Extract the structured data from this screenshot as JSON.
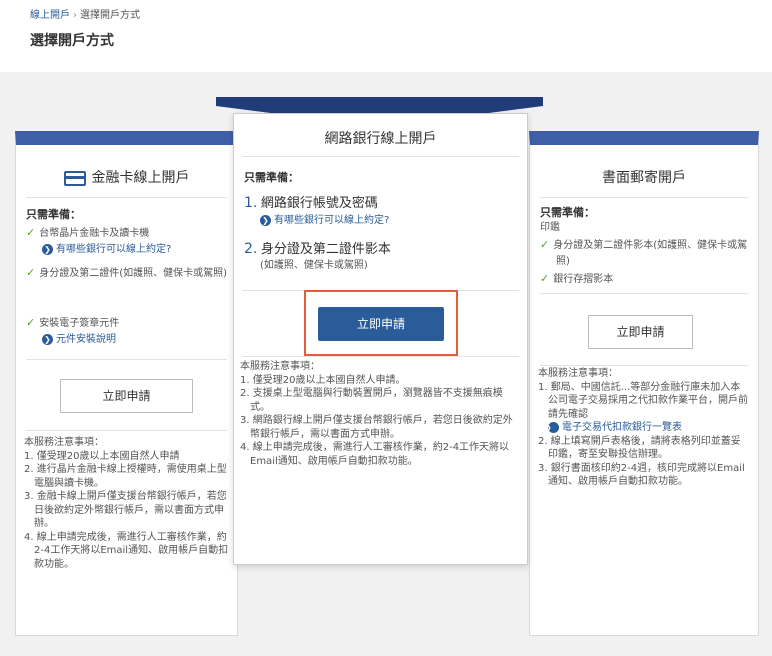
{
  "breadcrumb": {
    "home": "線上開戶",
    "sep": "›",
    "current": "選擇開戶方式"
  },
  "page_title": "選擇開戶方式",
  "left_card": {
    "title": "金融卡線上開戶",
    "prepare_label": "只需準備：",
    "items": [
      {
        "text": "台幣晶片金融卡及讀卡機",
        "link": "有哪些銀行可以線上約定?"
      },
      {
        "text": "身分證及第二證件(如護照、健保卡或駕照)"
      },
      {
        "text": "安裝電子簽章元件",
        "link": "元件安裝說明"
      }
    ],
    "apply_label": "立即申請",
    "notes_title": "本服務注意事項：",
    "notes": [
      "1. 僅受理20歲以上本國自然人申請",
      "2. 進行晶片金融卡線上授權時，需使用桌上型電腦與讀卡機。",
      "3. 金融卡線上開戶僅支援台幣銀行帳戶，若您日後欲約定外幣銀行帳戶，需以書面方式申辦。",
      "4. 線上申請完成後，需進行人工審核作業，約2-4工作天將以Email通知、啟用帳戶自動扣款功能。"
    ]
  },
  "mid_card": {
    "title": "網路銀行線上開戶",
    "prepare_label": "只需準備：",
    "item1_num": "1.",
    "item1_text": "網路銀行帳號及密碼",
    "item1_link": "有哪些銀行可以線上約定?",
    "item2_num": "2.",
    "item2_text": "身分證及第二證件影本",
    "item2_sub": "(如護照、健保卡或駕照)",
    "apply_label": "立即申請",
    "notes_title": "本服務注意事項：",
    "notes": [
      "1. 僅受理20歲以上本國自然人申請。",
      "2. 支援桌上型電腦與行動裝置開戶，瀏覽器皆不支援無痕模式。",
      "3. 網路銀行線上開戶僅支援台幣銀行帳戶，若您日後欲約定外幣銀行帳戶，需以書面方式申辦。",
      "4. 線上申請完成後，需進行人工審核作業，約2-4工作天將以Email通知、啟用帳戶自動扣款功能。"
    ]
  },
  "right_card": {
    "title": "書面郵寄開戶",
    "prepare_label": "只需準備：",
    "sub_label": "印鑑",
    "items": [
      {
        "text": "身分證及第二證件影本(如護照、健保卡或駕照)"
      },
      {
        "text": "銀行存摺影本"
      }
    ],
    "apply_label": "立即申請",
    "notes_title": "本服務注意事項：",
    "notes": [
      "1. 郵局、中國信託...等部分金融行庫未加入本公司電子交易採用之代扣款作業平台，開戶前請先確認",
      "2. 線上填寫開戶表格後，請將表格列印並蓋妥印鑑，寄至安聯投信辦理。",
      "3. 銀行書面核印約2-4週，核印完成將以Email通知、啟用帳戶自動扣款功能。"
    ],
    "note1_link": "電子交易代扣款銀行一覽表"
  },
  "colors": {
    "brand_blue": "#3e5fa8",
    "banner_navy": "#203d79",
    "primary_button": "#2a5c99",
    "check_green": "#5aa12d",
    "highlight_red": "#e35c3c"
  },
  "icons": [
    "card-icon",
    "check-icon",
    "arrow-circle-icon"
  ]
}
